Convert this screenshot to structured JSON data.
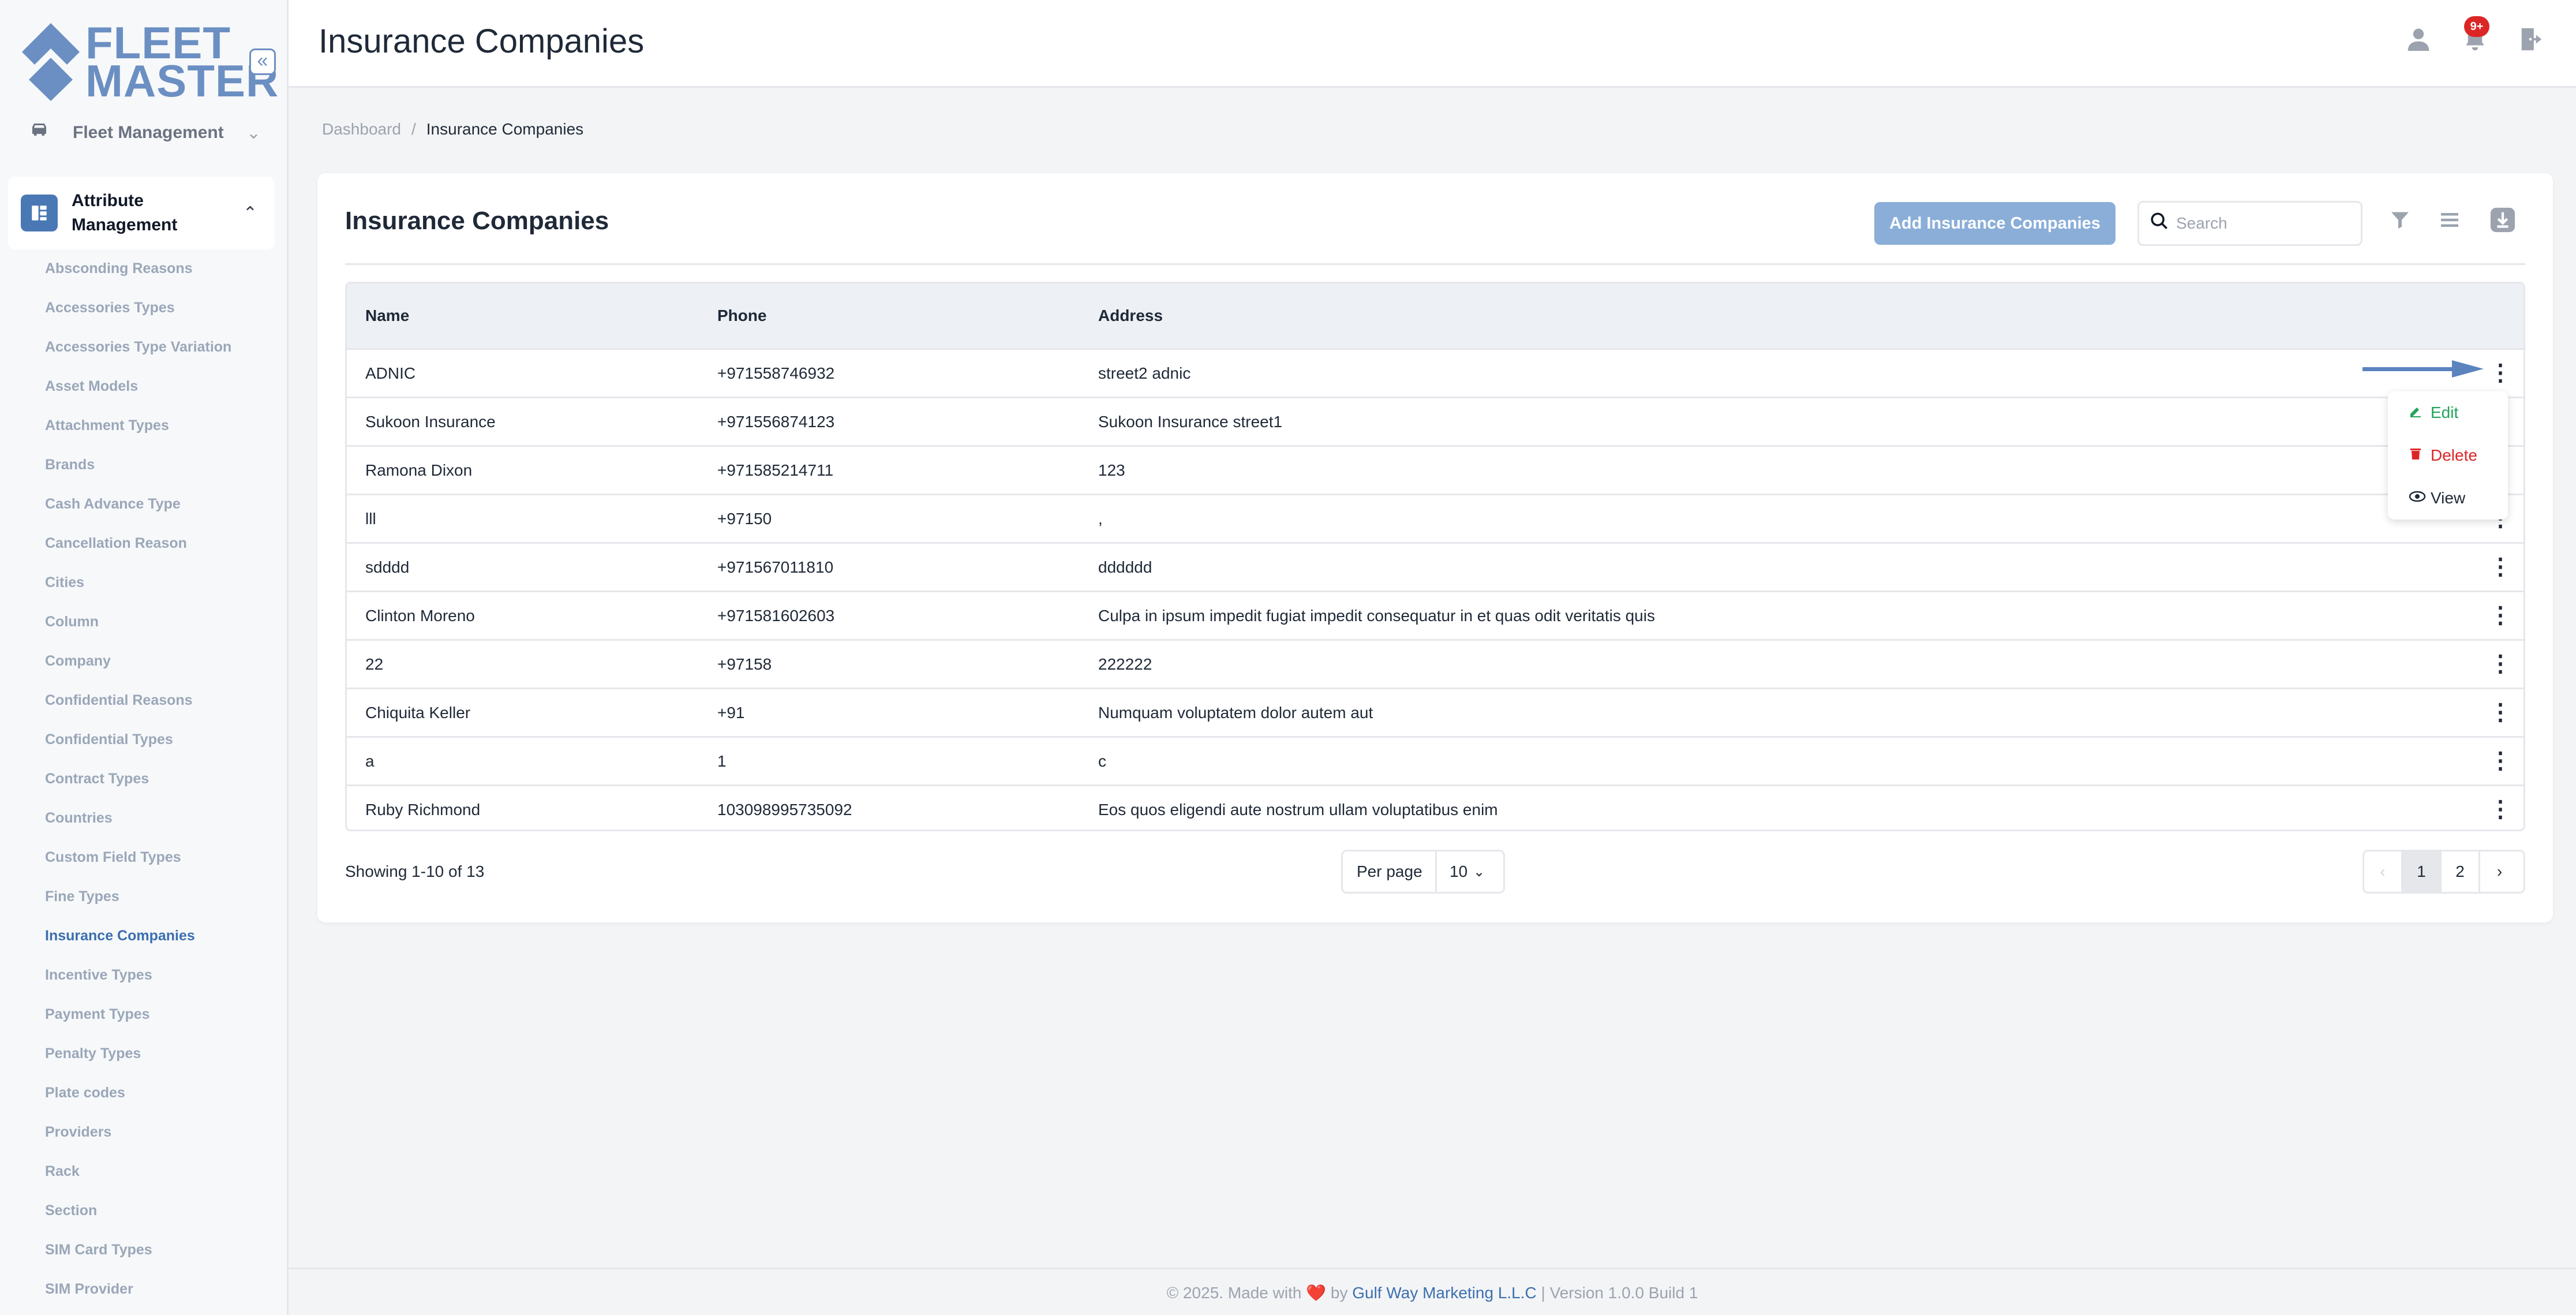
{
  "sidebar": {
    "logo_line1": "FLEET",
    "logo_line2": "MASTER",
    "collapse_glyph": "«",
    "fleet_management": "Fleet Management",
    "attribute_management": "Attribute Management",
    "items": [
      {
        "label": "Absconding Reasons"
      },
      {
        "label": "Accessories Types"
      },
      {
        "label": "Accessories Type Variation"
      },
      {
        "label": "Asset Models"
      },
      {
        "label": "Attachment Types"
      },
      {
        "label": "Brands"
      },
      {
        "label": "Cash Advance Type"
      },
      {
        "label": "Cancellation Reason"
      },
      {
        "label": "Cities"
      },
      {
        "label": "Column"
      },
      {
        "label": "Company"
      },
      {
        "label": "Confidential Reasons"
      },
      {
        "label": "Confidential Types"
      },
      {
        "label": "Contract Types"
      },
      {
        "label": "Countries"
      },
      {
        "label": "Custom Field Types"
      },
      {
        "label": "Fine Types"
      },
      {
        "label": "Insurance Companies"
      },
      {
        "label": "Incentive Types"
      },
      {
        "label": "Payment Types"
      },
      {
        "label": "Penalty Types"
      },
      {
        "label": "Plate codes"
      },
      {
        "label": "Providers"
      },
      {
        "label": "Rack"
      },
      {
        "label": "Section"
      },
      {
        "label": "SIM Card Types"
      },
      {
        "label": "SIM Provider"
      }
    ],
    "active_item": "Insurance Companies"
  },
  "header": {
    "title": "Insurance Companies",
    "notification_badge": "9+",
    "icons": [
      "user-icon",
      "bell-icon",
      "logout-icon"
    ]
  },
  "breadcrumb": {
    "home": "Dashboard",
    "separator": "/",
    "current": "Insurance Companies"
  },
  "card": {
    "title": "Insurance Companies",
    "add_button": "Add Insurance Companies",
    "search_placeholder": "Search",
    "tool_icons": [
      "filter-icon",
      "columns-icon",
      "download-icon"
    ]
  },
  "table": {
    "columns": [
      "Name",
      "Phone",
      "Address"
    ],
    "rows": [
      {
        "name": "ADNIC",
        "phone": "+971558746932",
        "address": "street2 adnic"
      },
      {
        "name": "Sukoon Insurance",
        "phone": "+971556874123",
        "address": "Sukoon Insurance street1"
      },
      {
        "name": "Ramona Dixon",
        "phone": "+971585214711",
        "address": "123"
      },
      {
        "name": "lll",
        "phone": "+97150",
        "address": ","
      },
      {
        "name": "sdddd",
        "phone": "+971567011810",
        "address": "dddddd"
      },
      {
        "name": "Clinton Moreno",
        "phone": "+971581602603",
        "address": "Culpa in ipsum impedit fugiat impedit consequatur in et quas odit veritatis quis"
      },
      {
        "name": "22",
        "phone": "+97158",
        "address": "222222"
      },
      {
        "name": "Chiquita Keller",
        "phone": "+91",
        "address": "Numquam voluptatem dolor autem aut"
      },
      {
        "name": "a",
        "phone": "1",
        "address": "c"
      },
      {
        "name": "Ruby Richmond",
        "phone": "103098995735092",
        "address": "Eos quos eligendi aute nostrum ullam voluptatibus enim"
      }
    ]
  },
  "row_menu": {
    "edit": "Edit",
    "delete": "Delete",
    "view": "View"
  },
  "pagination": {
    "showing": "Showing 1-10 of 13",
    "per_page_label": "Per page",
    "per_page_value": "10",
    "pages": [
      "1",
      "2"
    ],
    "current_page": "1",
    "prev_glyph": "‹",
    "next_glyph": "›"
  },
  "footer": {
    "prefix": "© 2025. Made with",
    "heart": "❤️",
    "by": "by",
    "company": "Gulf Way Marketing L.L.C",
    "version": "| Version 1.0.0 Build 1"
  },
  "colors": {
    "brand": "#6b8fc2",
    "active": "#3b6fb0",
    "add_button": "#8aaed8",
    "edit": "#22a35a",
    "delete": "#dc2626"
  }
}
